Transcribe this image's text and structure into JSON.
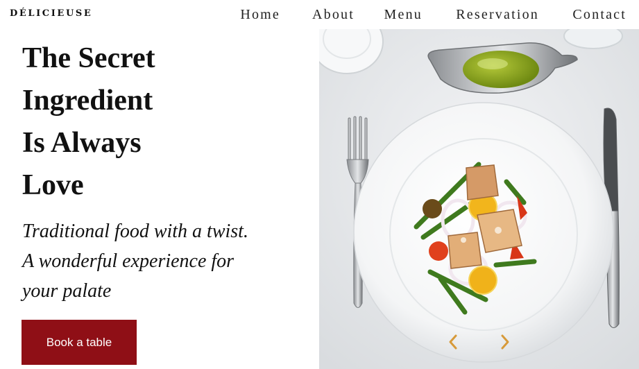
{
  "brand": {
    "name": "DÉLICIEUSE"
  },
  "nav": {
    "items": [
      {
        "label": "Home"
      },
      {
        "label": "About"
      },
      {
        "label": "Menu"
      },
      {
        "label": "Reservation"
      },
      {
        "label": "Contact"
      }
    ]
  },
  "hero": {
    "title_lines": [
      "The Secret",
      "Ingredient",
      "Is Always",
      "Love"
    ],
    "subtitle_lines": [
      "Traditional food with a twist.",
      "A wonderful experience for",
      "your palate"
    ],
    "cta_label": "Book a table"
  },
  "slider": {
    "prev_icon": "chevron-left-icon",
    "next_icon": "chevron-right-icon"
  },
  "colors": {
    "accent": "#8f0f16",
    "arrow": "#d79a3a",
    "text": "#111111"
  }
}
